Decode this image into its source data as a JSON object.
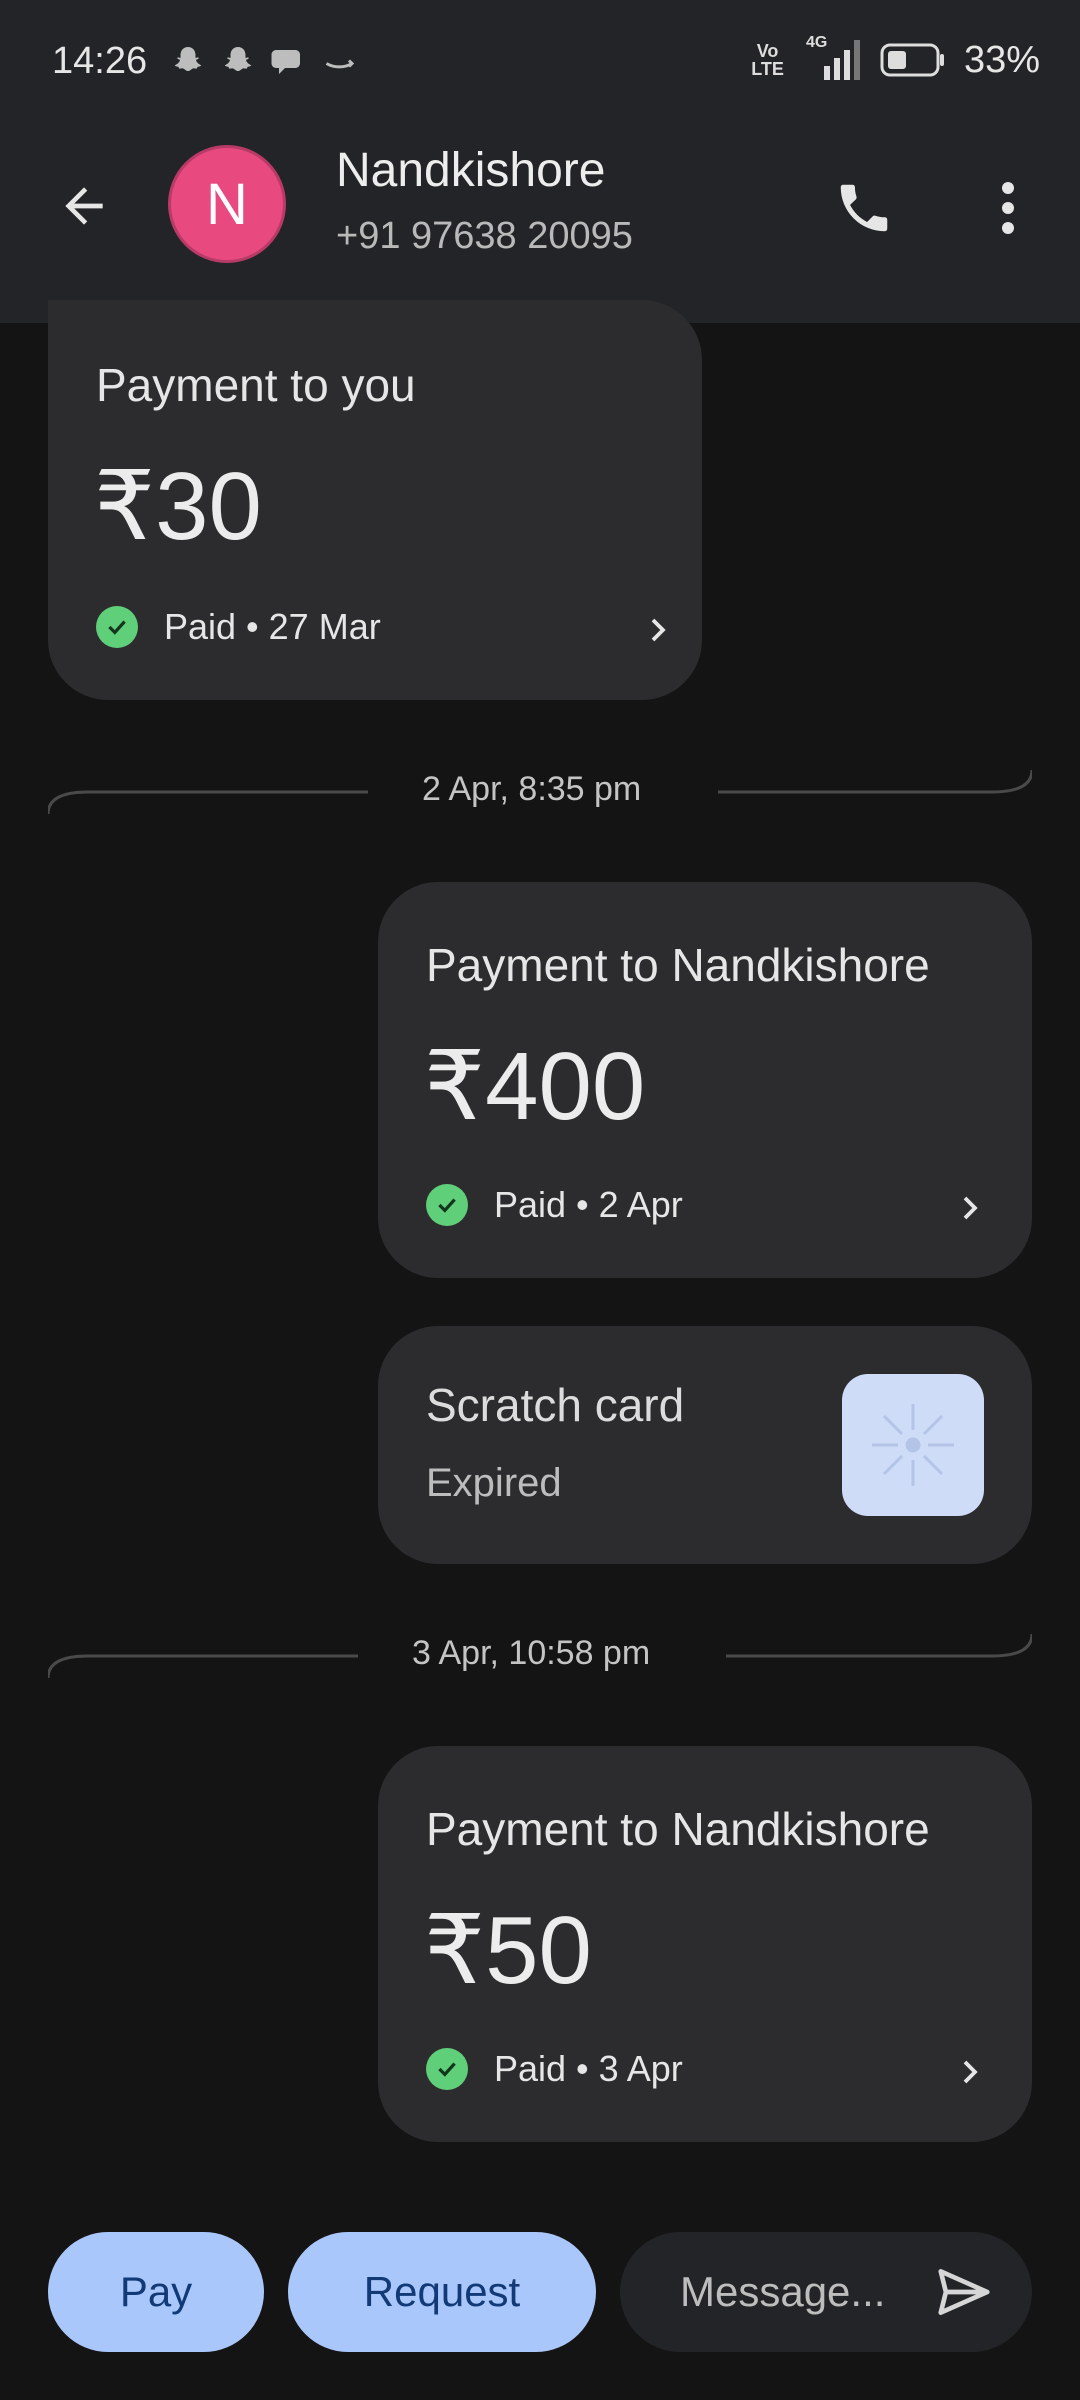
{
  "status_bar": {
    "time": "14:26",
    "volte_top": "Vo",
    "volte_bottom": "LTE",
    "network": "4G",
    "battery": "33%"
  },
  "header": {
    "avatar_letter": "N",
    "contact_name": "Nandkishore",
    "contact_phone": "+91 97638 20095",
    "avatar_color": "#e8497f"
  },
  "messages": [
    {
      "title": "Payment to you",
      "amount": "₹30",
      "status": "Paid • 27 Mar"
    },
    {
      "divider": "2 Apr, 8:35 pm"
    },
    {
      "title": "Payment to Nandkishore",
      "amount": "₹400",
      "status": "Paid • 2 Apr"
    },
    {
      "scratch_title": "Scratch card",
      "scratch_status": "Expired"
    },
    {
      "divider": "3 Apr, 10:58 pm"
    },
    {
      "title": "Payment to Nandkishore",
      "amount": "₹50",
      "status": "Paid • 3 Apr"
    }
  ],
  "bottom_bar": {
    "pay_label": "Pay",
    "request_label": "Request",
    "message_placeholder": "Message..."
  },
  "colors": {
    "background": "#141414",
    "card": "#2c2c2e",
    "accent_button": "#a9c7fa",
    "paid_check": "#5fcf7a"
  }
}
